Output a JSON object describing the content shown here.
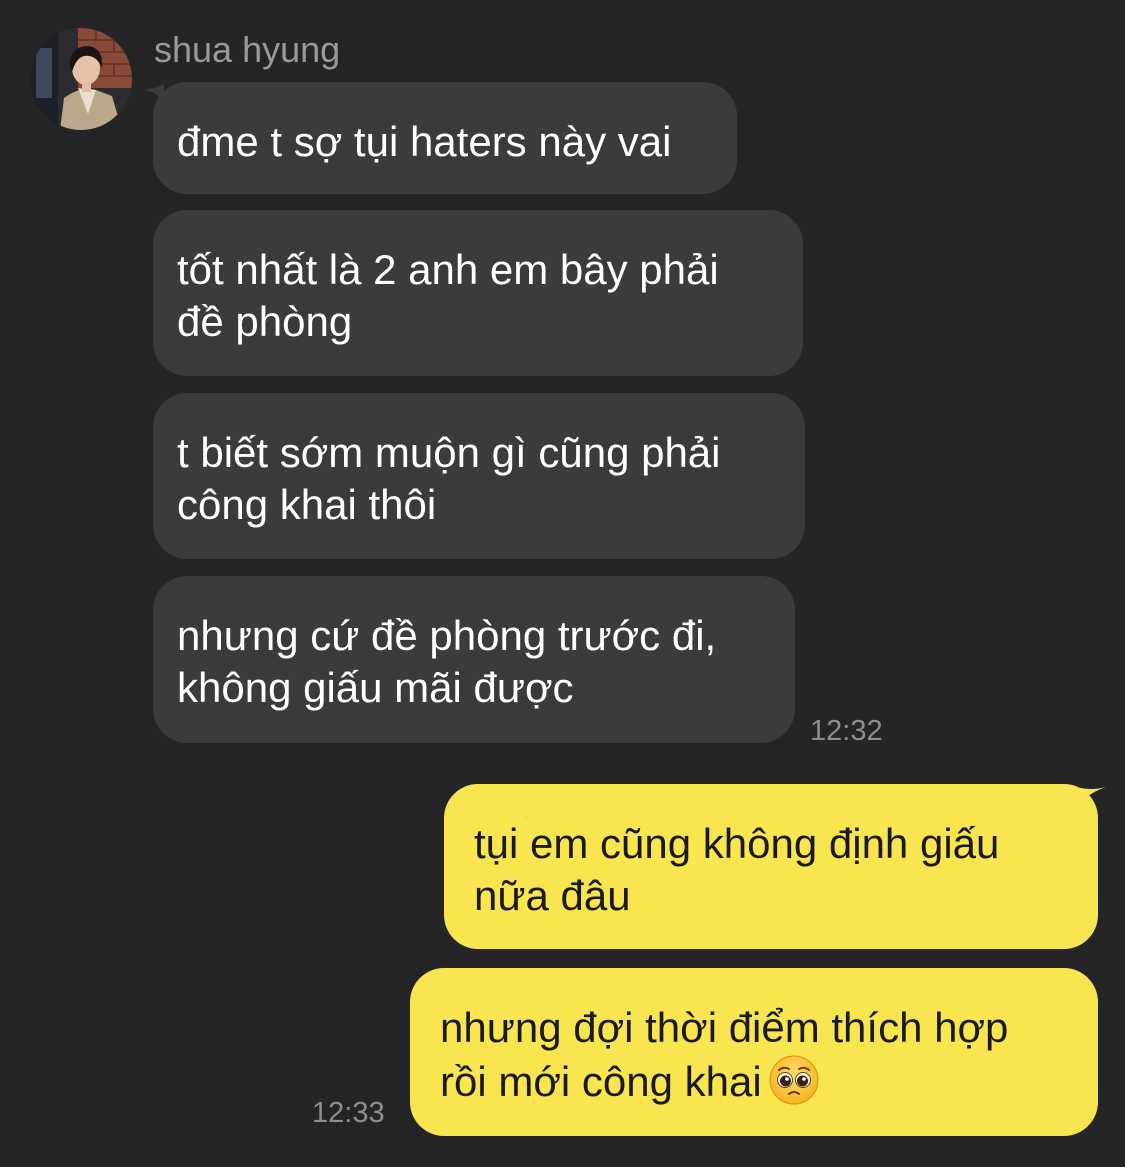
{
  "chat": {
    "sender_name": "shua hyung",
    "incoming": [
      {
        "lines": [
          "đme t sợ tụi haters này vai"
        ]
      },
      {
        "lines": [
          "tốt nhất là 2 anh em bây phải",
          "đề phòng"
        ]
      },
      {
        "lines": [
          "t biết sớm muộn gì cũng phải",
          "công khai thôi"
        ]
      },
      {
        "lines": [
          "nhưng cứ đề phòng trước đi,",
          "không giấu mãi được"
        ]
      }
    ],
    "incoming_time": "12:32",
    "outgoing": [
      {
        "lines": [
          "tụi em cũng không định giấu",
          "nữa đâu"
        ]
      },
      {
        "lines": [
          "nhưng đợi thời điểm thích hợp",
          "rồi mới công khai"
        ],
        "emoji": "pleading-face-emoji"
      }
    ],
    "outgoing_time": "12:33"
  },
  "colors": {
    "background": "#252527",
    "incoming_bubble": "#3b3b3e",
    "outgoing_bubble": "#f9e54f",
    "timestamp": "#8e8e92"
  }
}
